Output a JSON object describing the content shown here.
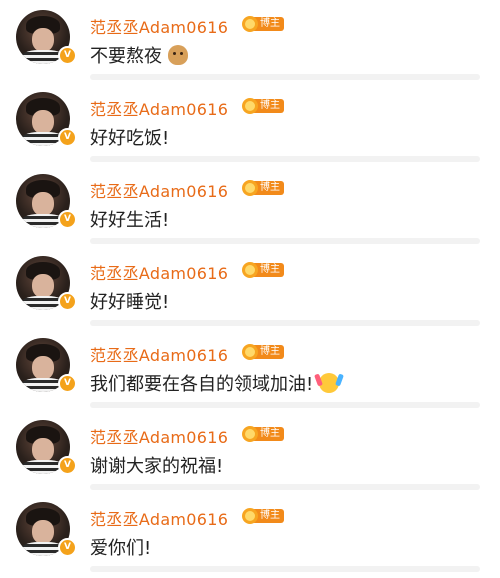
{
  "comments": [
    {
      "username": "范丞丞Adam0616",
      "badge": "博主",
      "message": "不要熬夜",
      "emoji": "doge-emoji"
    },
    {
      "username": "范丞丞Adam0616",
      "badge": "博主",
      "message": "好好吃饭!"
    },
    {
      "username": "范丞丞Adam0616",
      "badge": "博主",
      "message": "好好生活!"
    },
    {
      "username": "范丞丞Adam0616",
      "badge": "博主",
      "message": "好好睡觉!"
    },
    {
      "username": "范丞丞Adam0616",
      "badge": "博主",
      "message": "我们都要在各自的领域加油!",
      "emoji": "cheer-emoji"
    },
    {
      "username": "范丞丞Adam0616",
      "badge": "博主",
      "message": "谢谢大家的祝福!"
    },
    {
      "username": "范丞丞Adam0616",
      "badge": "博主",
      "message": "爱你们!"
    }
  ],
  "verified_mark": "V",
  "colors": {
    "username": "#e86b18",
    "badge": "#f28a1a",
    "verified": "#f4a21b",
    "text": "#222222",
    "separator": "#f2f2f2"
  }
}
